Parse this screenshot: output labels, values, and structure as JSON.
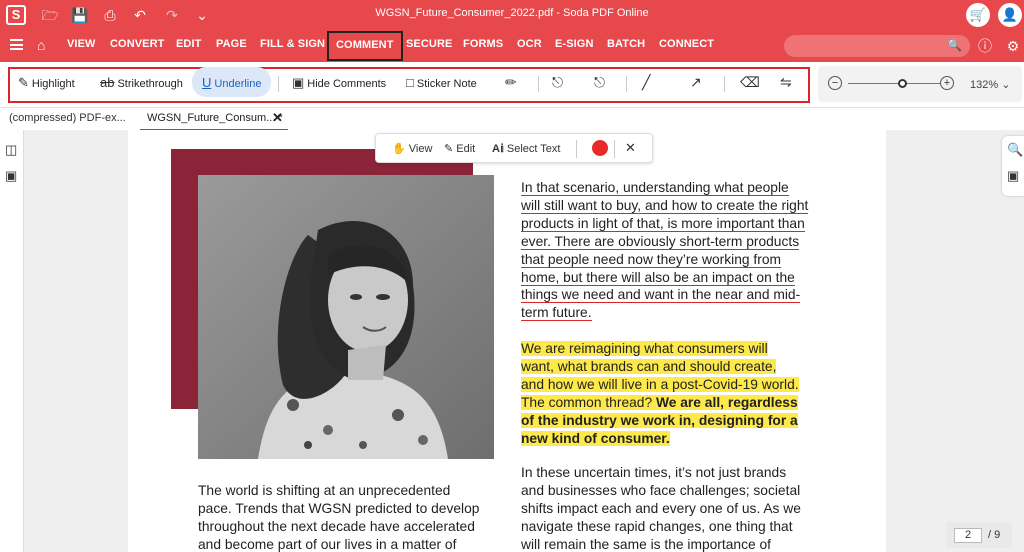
{
  "title_bar": {
    "logo": "S",
    "title": "WGSN_Future_Consumer_2022.pdf - Soda PDF Online",
    "icons": [
      "open-folder-icon",
      "save-icon",
      "print-icon",
      "undo-icon",
      "redo-icon",
      "chevron-down-icon",
      "cart-icon",
      "user-icon"
    ]
  },
  "menu": {
    "items": [
      "VIEW",
      "CONVERT",
      "EDIT",
      "PAGE",
      "FILL & SIGN",
      "COMMENT",
      "SECURE",
      "FORMS",
      "OCR",
      "E-SIGN",
      "BATCH",
      "CONNECT"
    ],
    "active": "COMMENT"
  },
  "comment_toolbar": {
    "highlight": "Highlight",
    "strikethrough": "Strikethrough",
    "underline": "Underline",
    "hide_comments": "Hide Comments",
    "sticker_note": "Sticker Note",
    "active_tool": "Underline"
  },
  "zoom": {
    "value": "132%",
    "level": 0.55
  },
  "tabs": [
    {
      "label": "(compressed)  PDF-ex..."
    },
    {
      "label": "WGSN_Future_Consum... *"
    }
  ],
  "floating_bar": {
    "view": "View",
    "edit": "Edit",
    "select_text": "Select Text"
  },
  "document": {
    "right_para1": [
      "In that scenario, understanding what people",
      "will still want to buy, and how to create the right",
      "products in light of that, is more important than",
      "ever. There are obviously short-term products",
      "that people need now they’re working from",
      "home, but there will also be an impact on the",
      "things we need and want in the near and mid-",
      "term future."
    ],
    "right_para2_normal": [
      "We are reimagining what consumers will",
      "want, what brands can and should create,",
      "and how we will live in a post-Covid-19 world.",
      "The common thread? "
    ],
    "right_para2_bold": [
      "We are all, regardless",
      "of the industry we work in, designing for a",
      "new kind of consumer."
    ],
    "right_para3": [
      "In these uncertain times, it’s not just brands",
      "and businesses who face challenges; societal",
      "shifts impact each and every one of us. As we",
      "navigate these rapid changes, one thing that",
      "will remain the same is the importance of"
    ],
    "left_para": [
      "The world is shifting at an unprecedented",
      "pace. Trends that WGSN predicted to develop",
      "throughout the next decade have accelerated",
      "and become part of our lives in a matter of"
    ]
  },
  "pager": {
    "current": "2",
    "total": "/ 9"
  },
  "colors": {
    "brand": "#e6484c",
    "accent_box": "#8b2438",
    "highlight": "#fde94a",
    "underline": "#d9262c"
  }
}
